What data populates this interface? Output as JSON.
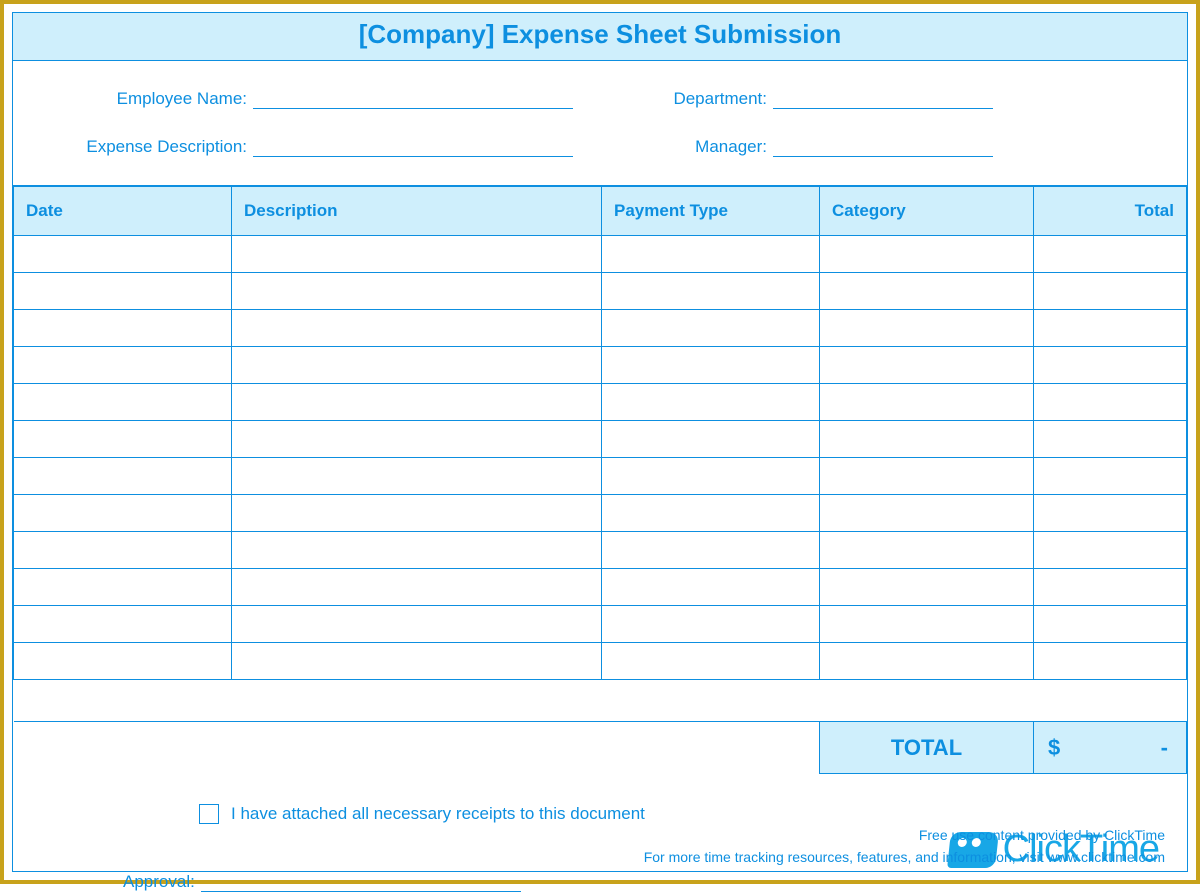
{
  "title": "[Company] Expense Sheet Submission",
  "info": {
    "employee_name_label": "Employee Name:",
    "department_label": "Department:",
    "expense_desc_label": "Expense Description:",
    "manager_label": "Manager:",
    "employee_name": "",
    "department": "",
    "expense_desc": "",
    "manager": ""
  },
  "table": {
    "headers": {
      "date": "Date",
      "description": "Description",
      "payment_type": "Payment Type",
      "category": "Category",
      "total": "Total"
    },
    "rows": [
      {
        "date": "",
        "description": "",
        "payment_type": "",
        "category": "",
        "total": ""
      },
      {
        "date": "",
        "description": "",
        "payment_type": "",
        "category": "",
        "total": ""
      },
      {
        "date": "",
        "description": "",
        "payment_type": "",
        "category": "",
        "total": ""
      },
      {
        "date": "",
        "description": "",
        "payment_type": "",
        "category": "",
        "total": ""
      },
      {
        "date": "",
        "description": "",
        "payment_type": "",
        "category": "",
        "total": ""
      },
      {
        "date": "",
        "description": "",
        "payment_type": "",
        "category": "",
        "total": ""
      },
      {
        "date": "",
        "description": "",
        "payment_type": "",
        "category": "",
        "total": ""
      },
      {
        "date": "",
        "description": "",
        "payment_type": "",
        "category": "",
        "total": ""
      },
      {
        "date": "",
        "description": "",
        "payment_type": "",
        "category": "",
        "total": ""
      },
      {
        "date": "",
        "description": "",
        "payment_type": "",
        "category": "",
        "total": ""
      },
      {
        "date": "",
        "description": "",
        "payment_type": "",
        "category": "",
        "total": ""
      },
      {
        "date": "",
        "description": "",
        "payment_type": "",
        "category": "",
        "total": ""
      }
    ],
    "total_label": "TOTAL",
    "total_currency": "$",
    "total_value": "-"
  },
  "receipts_label": "I have attached all necessary receipts to this document",
  "approval_label": "Approval:",
  "approval_value": "",
  "logo_text": "ClickTime",
  "footer_line1": "Free use content provided by ClickTime",
  "footer_line2": "For more time tracking resources, features, and information, visit www.clicktime.com"
}
